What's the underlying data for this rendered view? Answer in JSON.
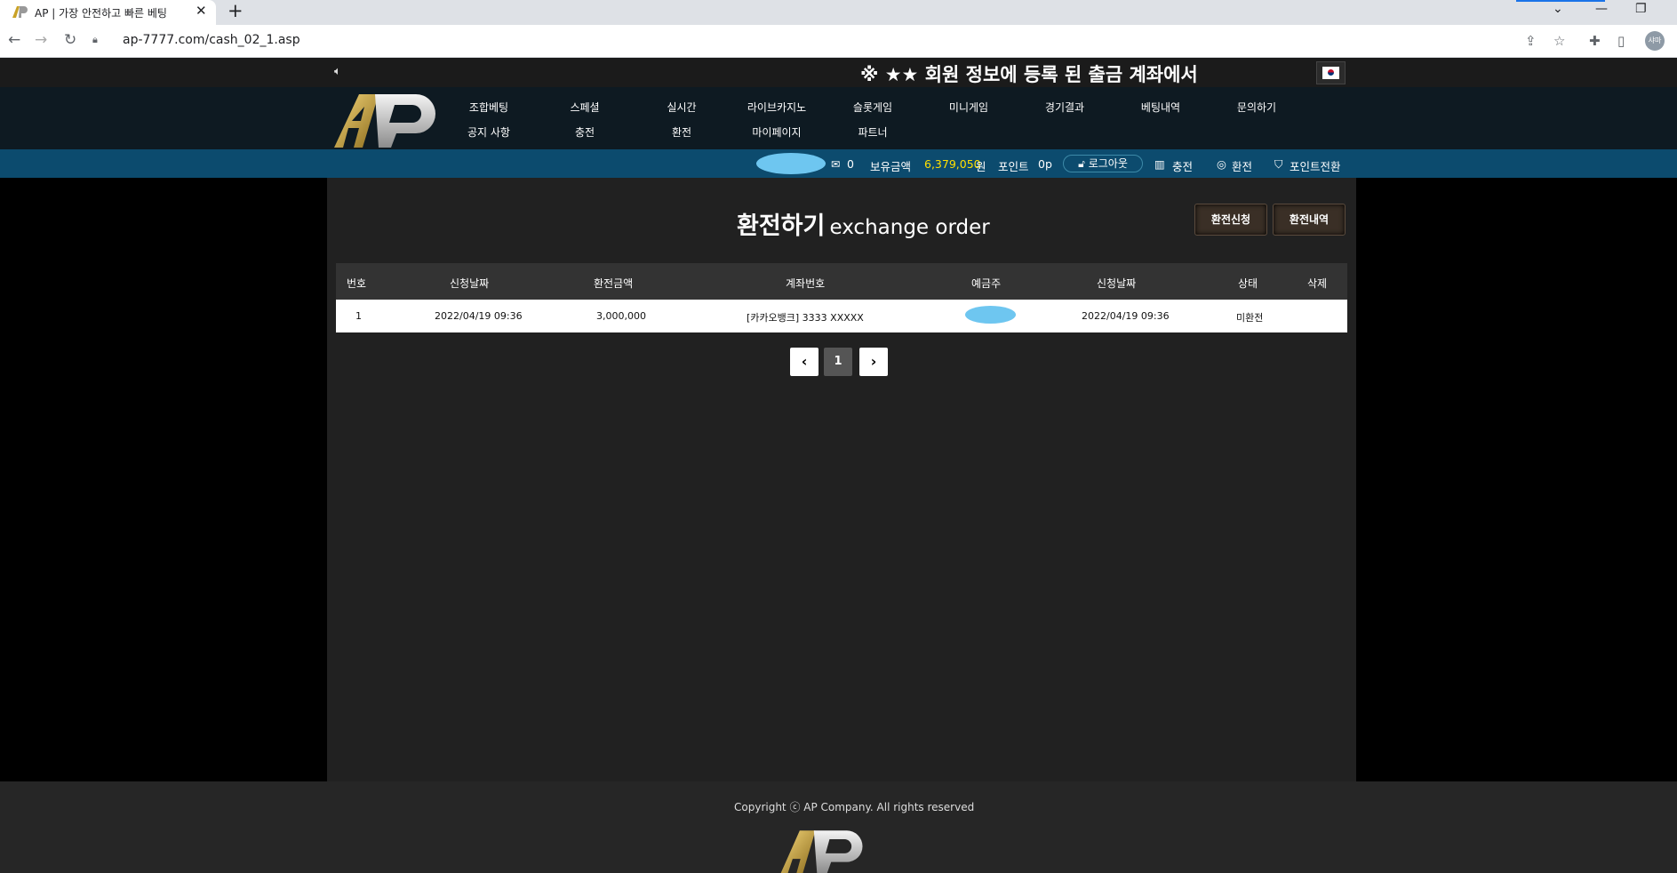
{
  "browser": {
    "tab_title": "AP | 가장 안전하고 빠른 베팅",
    "tab_close": "✕",
    "new_tab": "+",
    "url": "ap-7777.com/cash_02_1.asp",
    "profile_initials": "샤마"
  },
  "site": {
    "notice": "※ ★★ 회원 정보에 등록 된 출금 계좌에서",
    "nav_row1": [
      "조합베팅",
      "스페셜",
      "실시간",
      "라이브카지노",
      "슬롯게임",
      "미니게임",
      "경기결과",
      "베팅내역",
      "문의하기"
    ],
    "nav_row2": [
      "공지 사항",
      "충전",
      "환전",
      "마이페이지",
      "파트너"
    ],
    "user_bar": {
      "message_count": "0",
      "balance_label": "보유금액",
      "balance_value": "6,379,050",
      "balance_unit": "원",
      "point_label": "포인트",
      "point_value": "0p",
      "logout": "로그아웃",
      "deposit": "충전",
      "withdraw": "환전",
      "point_convert": "포인트전환"
    }
  },
  "page": {
    "title_ko": "환전하기",
    "title_en": "exchange order",
    "btn_apply": "환전신청",
    "btn_history": "환전내역"
  },
  "table": {
    "headers": [
      "번호",
      "신청날짜",
      "환전금액",
      "계좌번호",
      "예금주",
      "신청날짜",
      "상태",
      "삭제"
    ],
    "rows": [
      [
        "1",
        "2022/04/19 09:36",
        "3,000,000",
        "[카카오뱅크] 3333 XXXXX",
        "",
        "2022/04/19 09:36",
        "미환전",
        ""
      ]
    ]
  },
  "pagination": {
    "prev": "‹",
    "current": "1",
    "next": "›"
  },
  "footer": {
    "copyright": "Copyright ⓒ AP Company. All rights reserved"
  },
  "colors": {
    "user_bar": "#0c4b6e",
    "nav": "#0e1a22",
    "money": "#ffe000",
    "content_bg": "#212121"
  }
}
